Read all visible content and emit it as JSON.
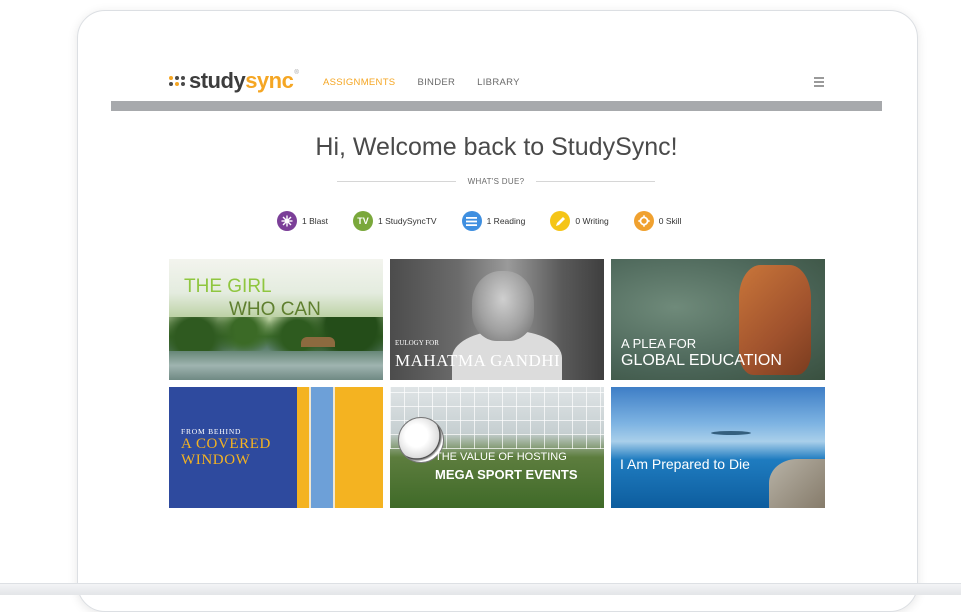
{
  "logo": {
    "prefix": "study",
    "accent": "sync",
    "tm": "®"
  },
  "nav": {
    "tabs": [
      {
        "label": "ASSIGNMENTS",
        "active": true
      },
      {
        "label": "BINDER",
        "active": false
      },
      {
        "label": "LIBRARY",
        "active": false
      }
    ],
    "menu_icon": "hamburger-menu-icon"
  },
  "welcome": {
    "title": "Hi, Welcome back to StudySync!",
    "due_label": "WHAT'S DUE?"
  },
  "due_counts": [
    {
      "label": "1 Blast",
      "icon": "blast-icon",
      "color": "#7b3f98"
    },
    {
      "label": "1 StudySyncTV",
      "icon": "tv-icon",
      "icon_text": "TV",
      "color": "#7aa83b"
    },
    {
      "label": "1 Reading",
      "icon": "reading-icon",
      "color": "#3f8fe0"
    },
    {
      "label": "0 Writing",
      "icon": "pencil-icon",
      "color": "#f5c518"
    },
    {
      "label": "0 Skill",
      "icon": "gear-icon",
      "color": "#f0a12f"
    }
  ],
  "tiles": [
    {
      "line1": "THE GIRL",
      "line2": "WHO CAN"
    },
    {
      "line1": "EULOGY FOR",
      "line2": "MAHATMA GANDHI"
    },
    {
      "line1": "A PLEA FOR",
      "line2": "GLOBAL EDUCATION"
    },
    {
      "line1": "FROM BEHIND",
      "line2": "A COVERED",
      "line3": "WINDOW"
    },
    {
      "line1": "THE VALUE OF HOSTING",
      "line2": "MEGA SPORT EVENTS"
    },
    {
      "line1": "I Am Prepared to Die"
    }
  ],
  "colors": {
    "accent": "#f5a623",
    "header_bar": "#a7a9ac"
  }
}
